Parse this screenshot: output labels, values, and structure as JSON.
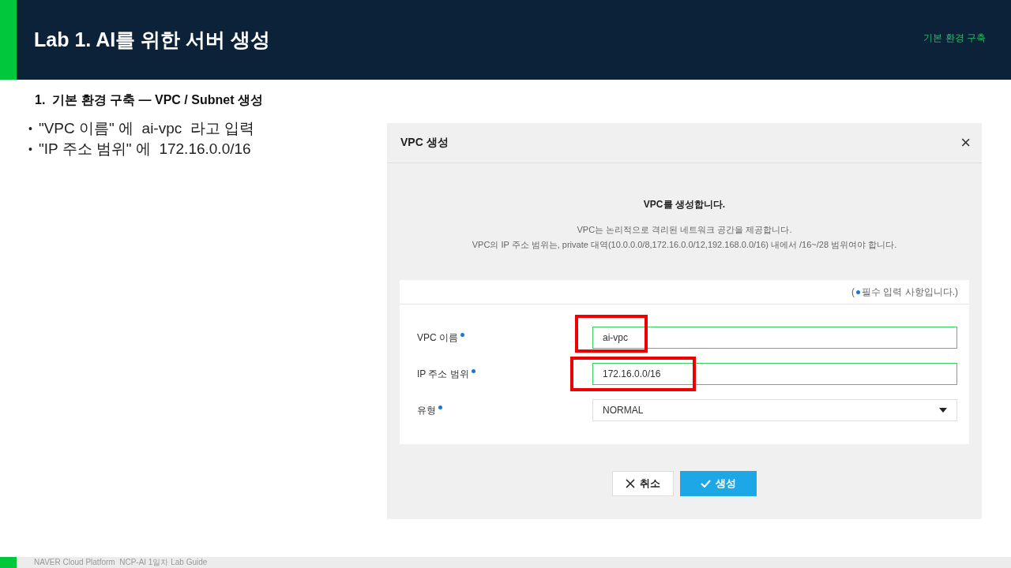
{
  "header": {
    "title": "Lab 1. AI를 위한 서버 생성",
    "section": "기본 환경 구축"
  },
  "heading": "1.  기본 환경 구축 — VPC / Subnet 생성",
  "bullets": [
    {
      "marker": "•",
      "text": "\"VPC 이름\" 에  ai-vpc  라고 입력"
    },
    {
      "marker": "•",
      "text": "\"IP 주소 범위\" 에  172.16.0.0/16"
    }
  ],
  "dialog": {
    "title": "VPC 생성",
    "close": "×",
    "lead": "VPC를 생성합니다.",
    "description": [
      "VPC는 논리적으로 격리된 네트워크 공간을 제공합니다.",
      "VPC의 IP 주소 범위는, private 대역(10.0.0.0/8,172.16.0.0/12,192.168.0.0/16) 내에서 /16~/28 범위여야 합니다."
    ],
    "required_note_open": "(",
    "required_note": "필수 입력 사항입니다.)",
    "fields": [
      {
        "kind": "input",
        "label": "VPC 이름",
        "required": true,
        "value": "ai-vpc",
        "highlighted": true
      },
      {
        "kind": "input",
        "label": "IP 주소 범위",
        "required": true,
        "value": "172.16.0.0/16",
        "highlighted": true
      },
      {
        "kind": "select",
        "label": "유형",
        "required": true,
        "value": "NORMAL",
        "highlighted": false
      }
    ],
    "buttons": [
      {
        "kind": "cancel",
        "label": "취소"
      },
      {
        "kind": "primary",
        "label": "생성"
      }
    ]
  },
  "footer": "NAVER Cloud Platform  NCP-AI 1일차 Lab Guide"
}
